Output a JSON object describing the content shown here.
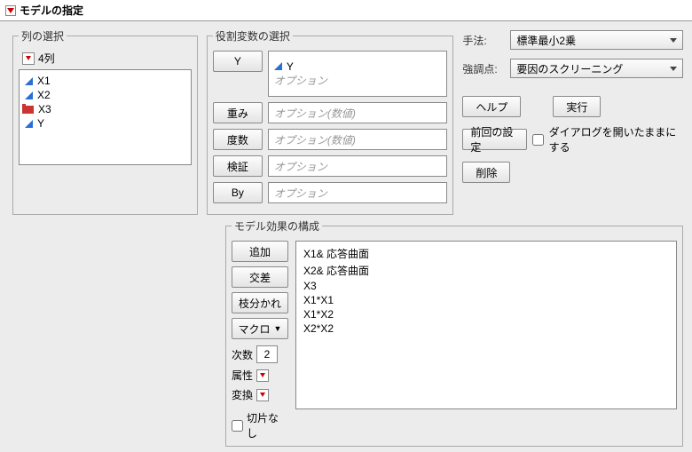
{
  "header": {
    "title": "モデルの指定"
  },
  "columns": {
    "legend": "列の選択",
    "count_label": "4列",
    "items": [
      "X1",
      "X2",
      "X3",
      "Y"
    ]
  },
  "roles": {
    "legend": "役割変数の選択",
    "y_btn": "Y",
    "y_value": "Y",
    "y_placeholder": "オプション",
    "weight_btn": "重み",
    "weight_placeholder": "オプション(数値)",
    "freq_btn": "度数",
    "freq_placeholder": "オプション(数値)",
    "valid_btn": "検証",
    "valid_placeholder": "オプション",
    "by_btn": "By",
    "by_placeholder": "オプション"
  },
  "settings": {
    "method_label": "手法:",
    "method_value": "標準最小2乗",
    "emphasis_label": "強調点:",
    "emphasis_value": "要因のスクリーニング",
    "help_btn": "ヘルプ",
    "run_btn": "実行",
    "recall_btn": "前回の設定",
    "keep_open_label": "ダイアログを開いたままにする",
    "remove_btn": "削除"
  },
  "effects": {
    "legend": "モデル効果の構成",
    "add_btn": "追加",
    "cross_btn": "交差",
    "nest_btn": "枝分かれ",
    "macro_btn": "マクロ",
    "degree_label": "次数",
    "degree_value": "2",
    "attr_label": "属性",
    "trans_label": "変換",
    "notrunc_label": "切片なし",
    "items": [
      "X1& 応答曲面",
      "X2& 応答曲面",
      "X3",
      "X1*X1",
      "X1*X2",
      "X2*X2"
    ]
  }
}
